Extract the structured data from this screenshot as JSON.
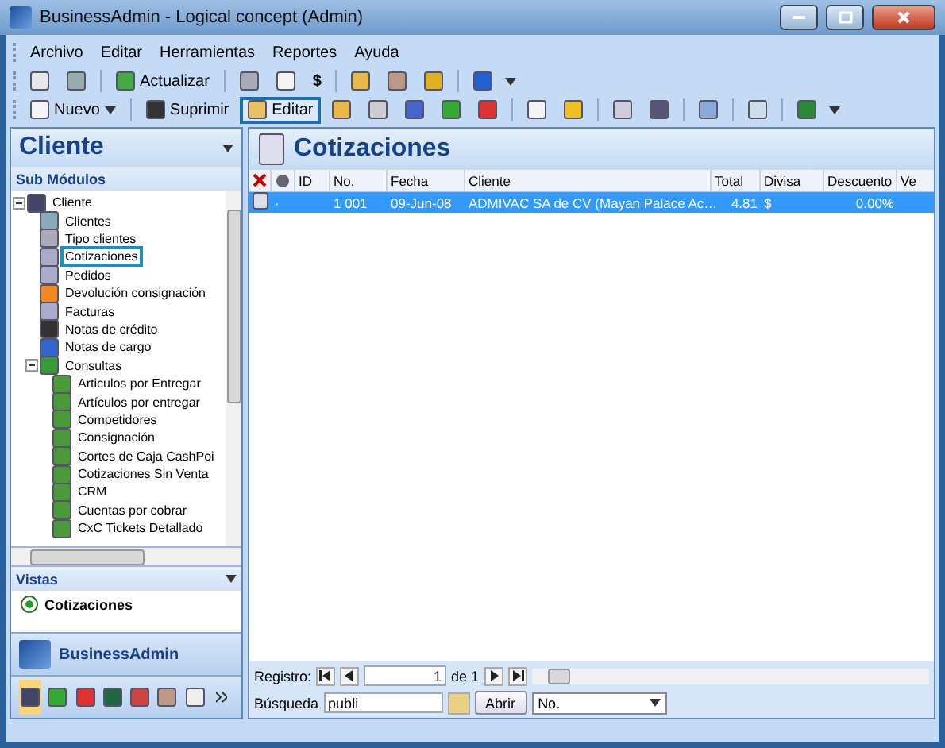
{
  "window": {
    "title": "BusinessAdmin - Logical concept (Admin)"
  },
  "menu": [
    "Archivo",
    "Editar",
    "Herramientas",
    "Reportes",
    "Ayuda"
  ],
  "toolbar_1": [
    {
      "kind": "icon"
    },
    {
      "kind": "icon"
    },
    {
      "kind": "sep"
    },
    {
      "kind": "button",
      "label": "Actualizar"
    },
    {
      "kind": "sep"
    },
    {
      "kind": "icon"
    },
    {
      "kind": "icon"
    },
    {
      "kind": "text",
      "label": "$"
    },
    {
      "kind": "sep"
    },
    {
      "kind": "icon"
    },
    {
      "kind": "icon"
    },
    {
      "kind": "icon"
    },
    {
      "kind": "sep"
    },
    {
      "kind": "icon"
    },
    {
      "kind": "more"
    }
  ],
  "toolbar_2": [
    {
      "kind": "dropdown",
      "label": "Nuevo",
      "focused": false
    },
    {
      "kind": "sep"
    },
    {
      "kind": "button",
      "label": "Suprimir",
      "focused": false
    },
    {
      "kind": "button",
      "label": "Editar",
      "focused": true
    },
    {
      "kind": "icon"
    },
    {
      "kind": "icon"
    },
    {
      "kind": "icon"
    },
    {
      "kind": "icon"
    },
    {
      "kind": "icon"
    },
    {
      "kind": "sep"
    },
    {
      "kind": "icon"
    },
    {
      "kind": "icon"
    },
    {
      "kind": "sep"
    },
    {
      "kind": "icon"
    },
    {
      "kind": "icon"
    },
    {
      "kind": "sep"
    },
    {
      "kind": "icon"
    },
    {
      "kind": "sep"
    },
    {
      "kind": "icon"
    },
    {
      "kind": "sep"
    },
    {
      "kind": "icon"
    },
    {
      "kind": "more"
    }
  ],
  "sidebar": {
    "title": "Cliente",
    "section": "Sub Módulos",
    "tree": [
      {
        "label": "Cliente",
        "expanded": true,
        "focused": false,
        "children": [
          {
            "label": "Clientes",
            "focused": false
          },
          {
            "label": "Tipo clientes",
            "focused": false
          },
          {
            "label": "Cotizaciones",
            "focused": true
          },
          {
            "label": "Pedidos",
            "focused": false
          },
          {
            "label": "Devolución consignación",
            "focused": false
          },
          {
            "label": "Facturas",
            "focused": false
          },
          {
            "label": "Notas de crédito",
            "focused": false
          },
          {
            "label": "Notas de cargo",
            "focused": false
          },
          {
            "label": "Consultas",
            "expanded": true,
            "focused": false,
            "children": [
              {
                "label": "Articulos por Entregar",
                "focused": false
              },
              {
                "label": "Artículos por entregar",
                "focused": false
              },
              {
                "label": "Competidores",
                "focused": false
              },
              {
                "label": "Consignación",
                "focused": false
              },
              {
                "label": "Cortes de Caja CashPoi",
                "focused": false
              },
              {
                "label": "Cotizaciones Sin Venta",
                "focused": false
              },
              {
                "label": "CRM",
                "focused": false
              },
              {
                "label": "Cuentas por cobrar",
                "focused": false
              },
              {
                "label": "CxC Tickets Detallado",
                "focused": false
              }
            ]
          }
        ]
      }
    ],
    "views_title": "Vistas",
    "views": [
      {
        "label": "Cotizaciones",
        "selected": true
      }
    ],
    "nav_title": "BusinessAdmin",
    "nav_icons": [
      {
        "selected": true
      },
      {
        "selected": false
      },
      {
        "selected": false
      },
      {
        "selected": false
      },
      {
        "selected": false
      },
      {
        "selected": false
      },
      {
        "selected": false
      }
    ]
  },
  "grid": {
    "title": "Cotizaciones",
    "columns": [
      "ID",
      "No.",
      "Fecha",
      "Cliente",
      "Total",
      "Divisa",
      "Descuento",
      "Ve"
    ],
    "rows": [
      {
        "selected": true,
        "marker": "·",
        "cells": [
          "",
          "1 001",
          "09-Jun-08",
          "ADMIVAC SA de CV (Mayan Palace Ac…",
          "4.81",
          "$",
          "0.00%"
        ]
      }
    ],
    "footer": {
      "record_label": "Registro:",
      "record_value": "1",
      "record_total": "de 1",
      "search_label": "Búsqueda",
      "search_value": "publi",
      "open_button": "Abrir",
      "field_select": "No."
    }
  }
}
